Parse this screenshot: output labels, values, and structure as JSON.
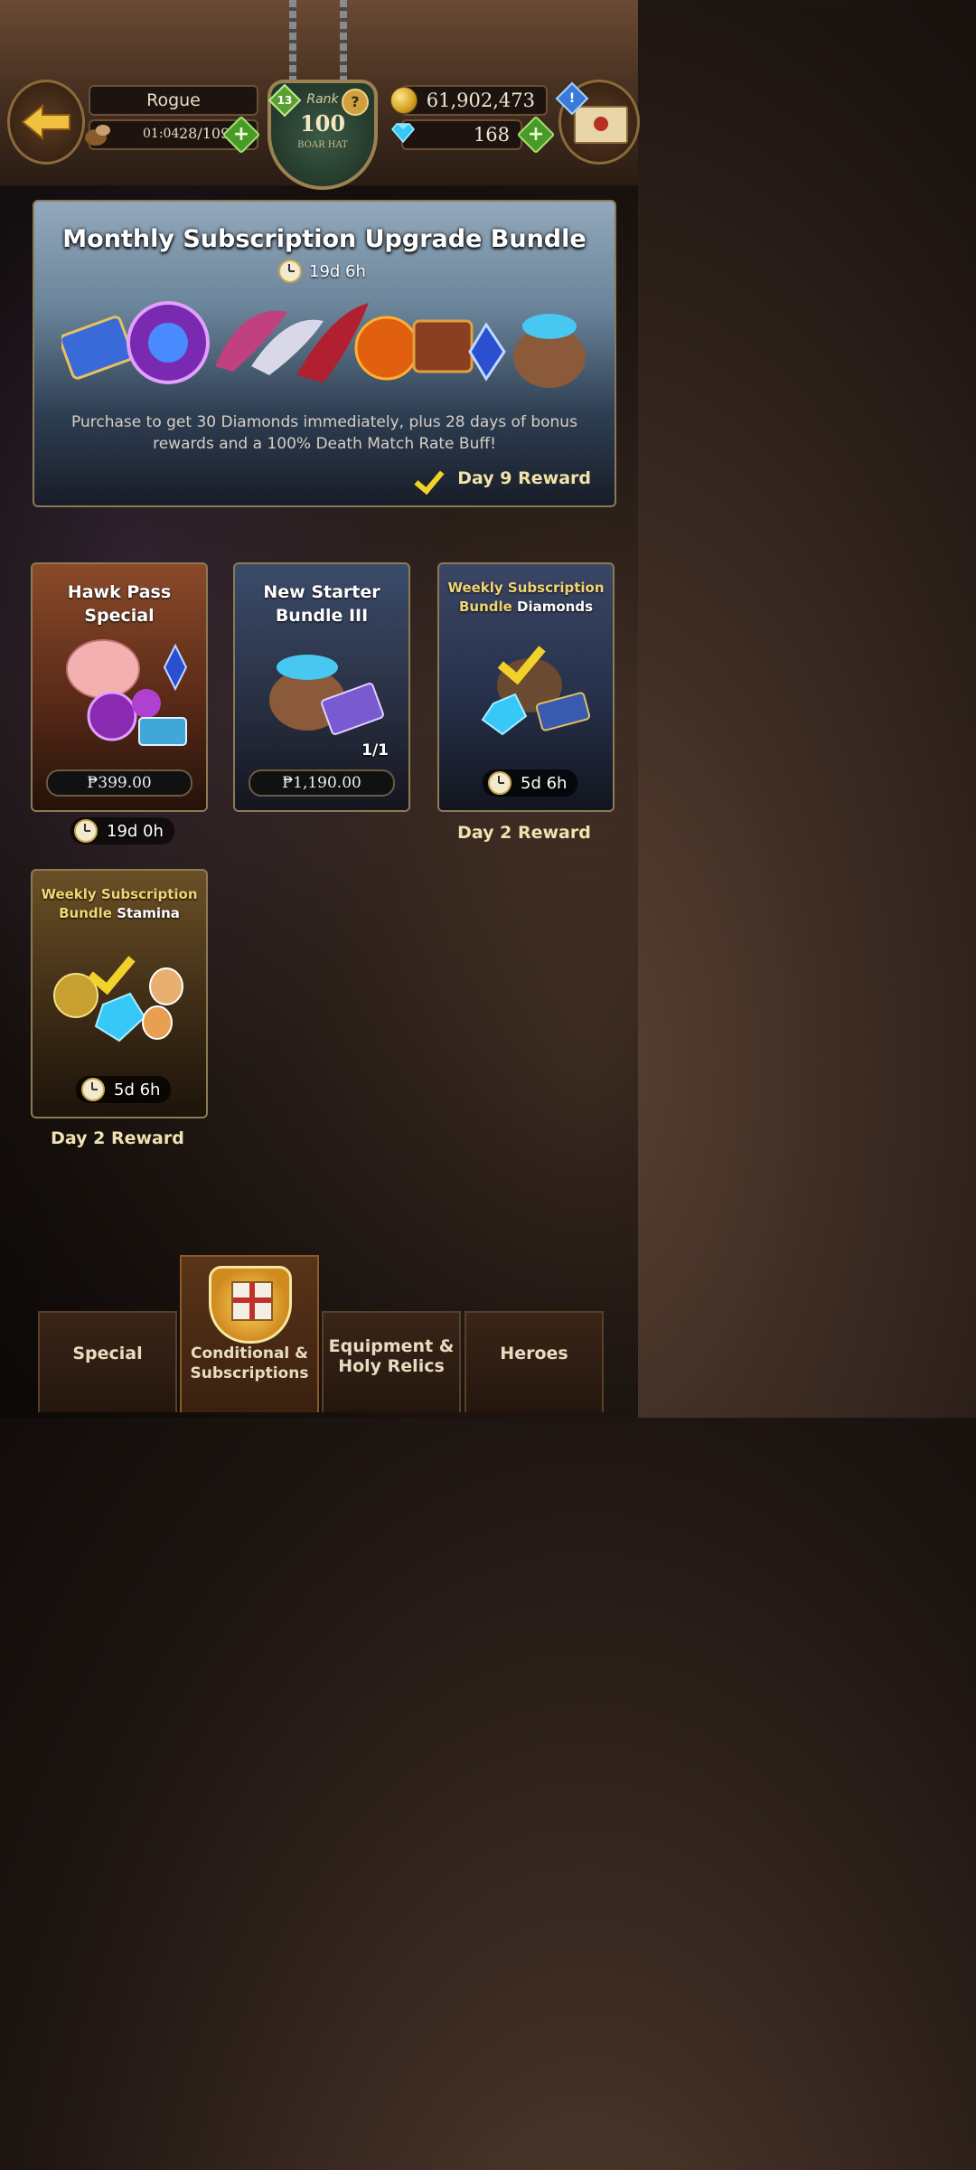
{
  "header": {
    "player_name": "Rogue",
    "stamina_timer": "01:04",
    "stamina_count": "28/109",
    "level": "13",
    "rank_label": "Rank",
    "rank_value": "100",
    "rank_title": "BOAR HAT",
    "gold": "61,902,473",
    "diamonds": "168"
  },
  "banner": {
    "title": "Monthly Subscription Upgrade Bundle",
    "timer": "19d 6h",
    "description": "Purchase to get 30 Diamonds immediately, plus 28 days of bonus rewards and a 100% Death Match Rate Buff!",
    "reward_label": "Day 9 Reward"
  },
  "cards": [
    {
      "title_line1": "Hawk Pass",
      "title_line2": "Special",
      "price": "₱399.00",
      "timer": "19d 0h"
    },
    {
      "title_line1": "New Starter",
      "title_line2": "Bundle III",
      "price": "₱1,190.00",
      "count": "1/1"
    },
    {
      "title_line1": "Weekly Subscription",
      "title_line2_a": "Bundle",
      "title_line2_b": "Diamonds",
      "timer": "5d 6h",
      "reward_label": "Day 2 Reward"
    },
    {
      "title_line1": "Weekly Subscription",
      "title_line2_a": "Bundle",
      "title_line2_b": "Stamina",
      "timer": "5d 6h",
      "reward_label": "Day 2 Reward"
    }
  ],
  "tabs": [
    {
      "label": "Special"
    },
    {
      "label_line1": "Conditional &",
      "label_line2": "Subscriptions"
    },
    {
      "label_line1": "Equipment &",
      "label_line2": "Holy Relics"
    },
    {
      "label": "Heroes"
    }
  ],
  "icons": {
    "back": "back-arrow-icon",
    "mail": "mail-icon",
    "gold": "gold-coin-icon",
    "diamond": "diamond-icon",
    "clock": "clock-icon",
    "check": "checkmark-icon",
    "help": "help-icon",
    "alert": "alert-icon"
  },
  "colors": {
    "accent_gold": "#f2d674",
    "check_yellow": "#f2d22a",
    "plus_green": "#4a9a2a",
    "panel_border": "#8c7a55"
  }
}
